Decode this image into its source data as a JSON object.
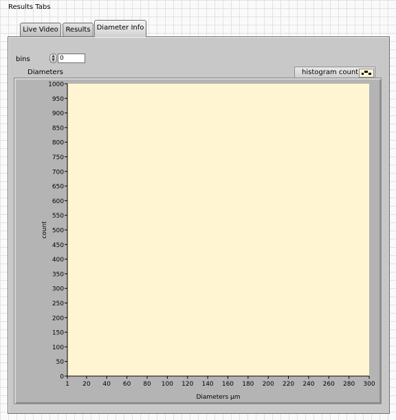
{
  "panel": {
    "tabs_label": "Results Tabs",
    "tabs": [
      {
        "label": "Live Video",
        "active": false
      },
      {
        "label": "Results",
        "active": false
      },
      {
        "label": "Diameter Info",
        "active": true
      }
    ]
  },
  "controls": {
    "bins_label": "bins",
    "bins_value": "0"
  },
  "graph": {
    "label": "Diameters",
    "legend_label": "histogram count",
    "plot_background": "#fff5d3"
  },
  "chart_data": {
    "type": "bar",
    "title": "",
    "xlabel": "Diameters μm",
    "ylabel": "count",
    "xlim": [
      1,
      300
    ],
    "ylim": [
      0,
      1000
    ],
    "x_ticks": [
      1,
      20,
      40,
      60,
      80,
      100,
      120,
      140,
      160,
      180,
      200,
      220,
      240,
      260,
      280,
      300
    ],
    "y_ticks": [
      0,
      50,
      100,
      150,
      200,
      250,
      300,
      350,
      400,
      450,
      500,
      550,
      600,
      650,
      700,
      750,
      800,
      850,
      900,
      950,
      1000
    ],
    "series": [
      {
        "name": "histogram count",
        "values": []
      }
    ],
    "legend": "top-right",
    "grid": false
  }
}
